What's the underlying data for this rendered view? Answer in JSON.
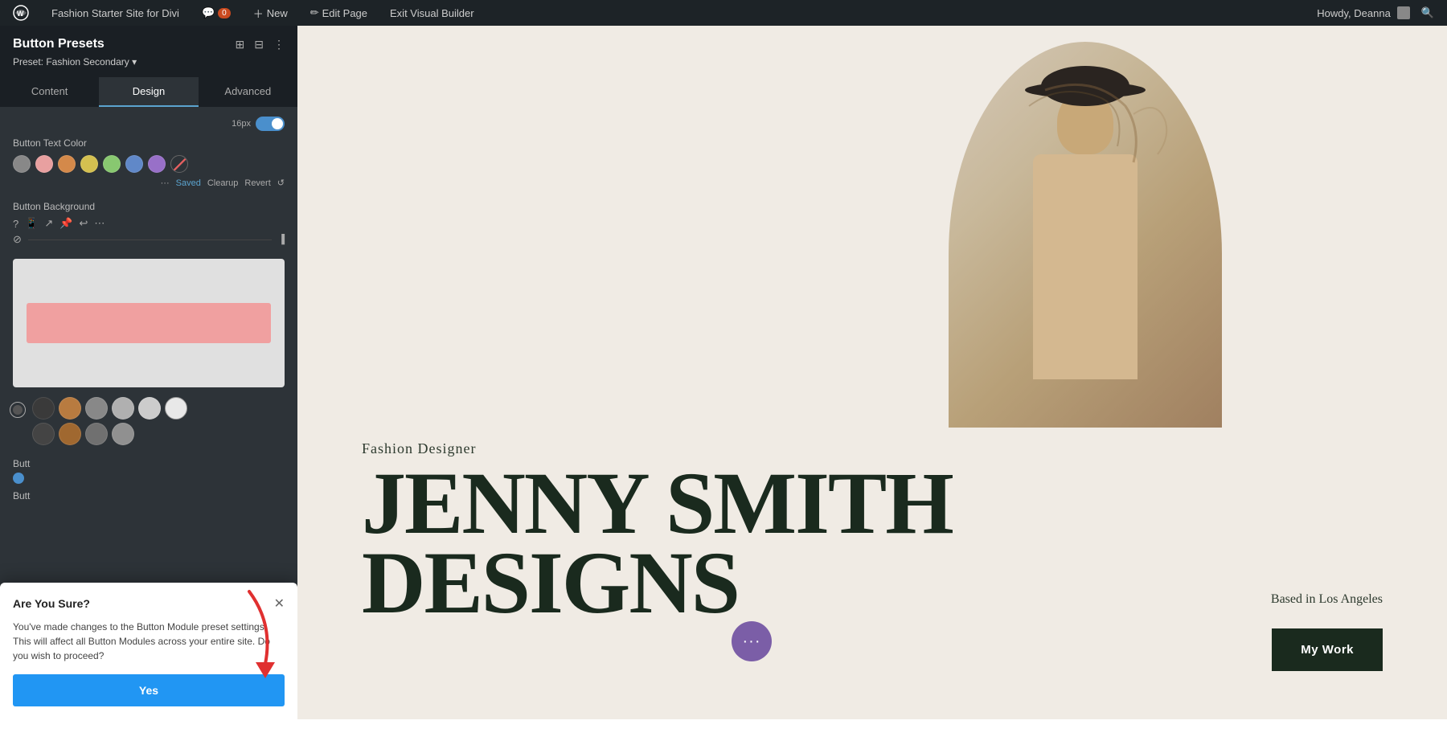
{
  "admin_bar": {
    "site_name": "Fashion Starter Site for Divi",
    "comment_count": "0",
    "new_label": "New",
    "edit_page_label": "Edit Page",
    "exit_builder_label": "Exit Visual Builder",
    "howdy_label": "Howdy, Deanna"
  },
  "panel": {
    "title": "Button Presets",
    "preset_label": "Preset: Fashion Secondary",
    "tabs": [
      {
        "id": "content",
        "label": "Content"
      },
      {
        "id": "design",
        "label": "Design"
      },
      {
        "id": "advanced",
        "label": "Advanced"
      }
    ],
    "active_tab": "design",
    "button_text_color_label": "Button Text Color",
    "button_background_label": "Button Background",
    "history": {
      "saved_label": "Saved",
      "clear_label": "Clearup",
      "revert_label": "Revert"
    }
  },
  "confirm_dialog": {
    "title": "Are You Sure?",
    "message": "You've made changes to the Button Module preset settings. This will affect all Button Modules across your entire site. Do you wish to proceed?",
    "yes_label": "Yes"
  },
  "hero": {
    "subtitle": "Fashion Designer",
    "name_line1": "JENNY SMITH",
    "name_line2": "DESIGNS",
    "based_text": "Based in Los Angeles",
    "cta_label": "My Work"
  }
}
